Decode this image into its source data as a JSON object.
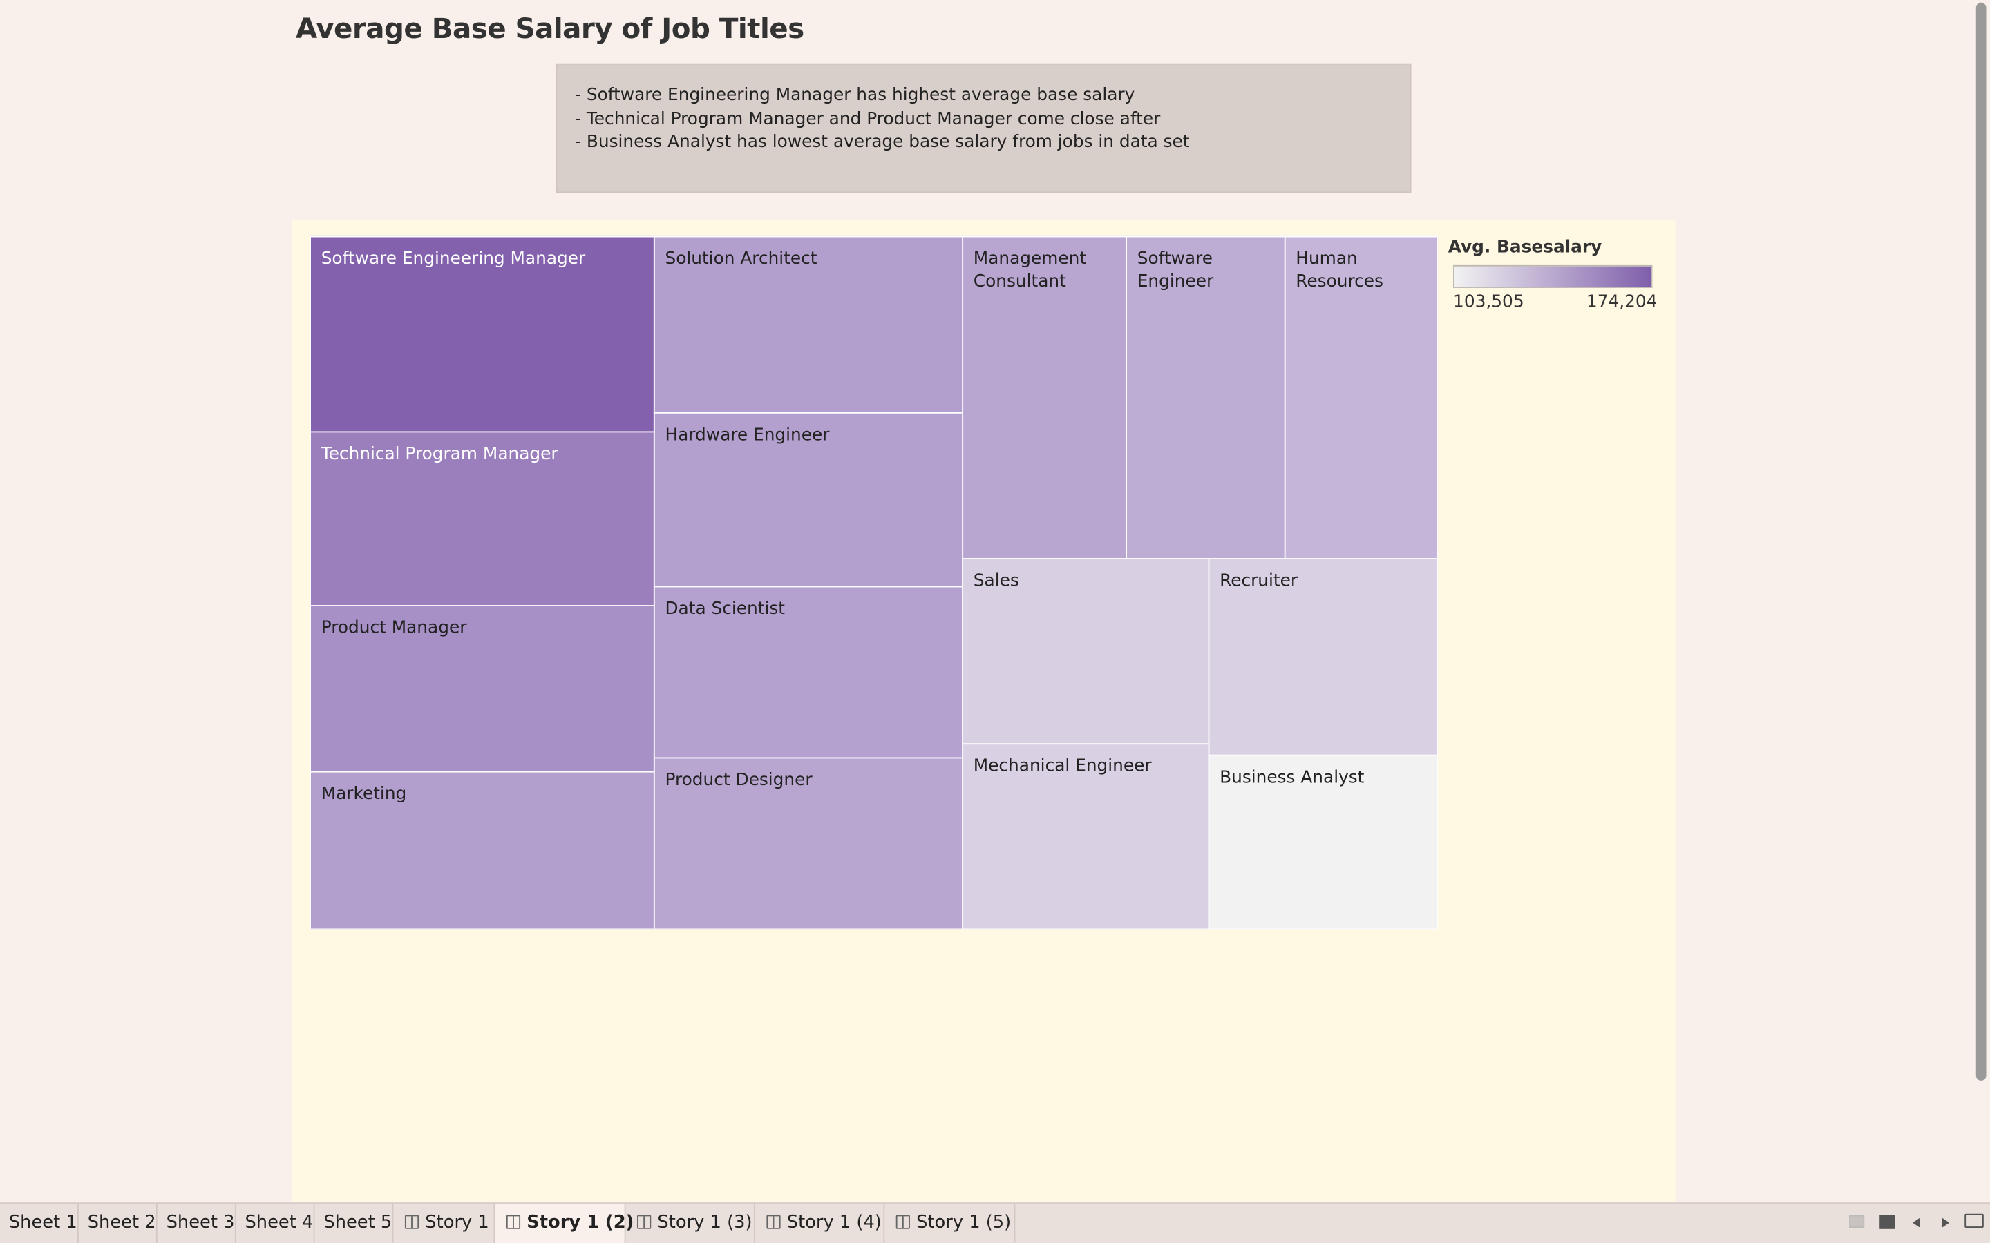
{
  "title": "Average Base Salary of Job Titles",
  "notes": [
    "- Software Engineering Manager has highest average base salary",
    "- Technical Program Manager and Product Manager come close after",
    "- Business Analyst has lowest average base salary from jobs in data set"
  ],
  "legend": {
    "title": "Avg. Basesalary",
    "min_label": "103,505",
    "max_label": "174,204",
    "color_low": "#f2f2f2",
    "color_high": "#7f5fab"
  },
  "chart_data": {
    "type": "treemap",
    "title": "Average Base Salary of Job Titles",
    "color_measure": "Avg. Basesalary",
    "color_range": [
      103505,
      174204
    ],
    "items": [
      {
        "label": "Software Engineering Manager",
        "avg_base_salary": 174204,
        "color": "#8361ad"
      },
      {
        "label": "Technical Program Manager",
        "avg_base_salary": 158000,
        "color": "#9b7fbc"
      },
      {
        "label": "Product Manager",
        "avg_base_salary": 153000,
        "color": "#a690c6"
      },
      {
        "label": "Marketing",
        "avg_base_salary": 149000,
        "color": "#b29fcd"
      },
      {
        "label": "Solution Architect",
        "avg_base_salary": 149000,
        "color": "#b29fcd"
      },
      {
        "label": "Hardware Engineer",
        "avg_base_salary": 148000,
        "color": "#b4a0ce"
      },
      {
        "label": "Data Scientist",
        "avg_base_salary": 148000,
        "color": "#b4a1cf"
      },
      {
        "label": "Product Designer",
        "avg_base_salary": 146000,
        "color": "#b8a6d0"
      },
      {
        "label": "Management Consultant",
        "avg_base_salary": 146000,
        "color": "#b8a6d0"
      },
      {
        "label": "Software Engineer",
        "avg_base_salary": 144000,
        "color": "#bdadd4"
      },
      {
        "label": "Human Resources",
        "avg_base_salary": 141000,
        "color": "#c5b6d9"
      },
      {
        "label": "Sales",
        "avg_base_salary": 130000,
        "color": "#d8cfe3"
      },
      {
        "label": "Recruiter",
        "avg_base_salary": 130000,
        "color": "#d9d0e4"
      },
      {
        "label": "Mechanical Engineer",
        "avg_base_salary": 130000,
        "color": "#d9d0e4"
      },
      {
        "label": "Business Analyst",
        "avg_base_salary": 103505,
        "color": "#f2f2f3"
      }
    ]
  },
  "tabs": [
    {
      "label": "Sheet 1",
      "type": "sheet"
    },
    {
      "label": "Sheet 2",
      "type": "sheet"
    },
    {
      "label": "Sheet 3",
      "type": "sheet"
    },
    {
      "label": "Sheet 4",
      "type": "sheet"
    },
    {
      "label": "Sheet 5",
      "type": "sheet"
    },
    {
      "label": "Story 1",
      "type": "story"
    },
    {
      "label": "Story 1 (2)",
      "type": "story",
      "active": true
    },
    {
      "label": "Story 1 (3)",
      "type": "story"
    },
    {
      "label": "Story 1 (4)",
      "type": "story"
    },
    {
      "label": "Story 1 (5)",
      "type": "story"
    }
  ]
}
